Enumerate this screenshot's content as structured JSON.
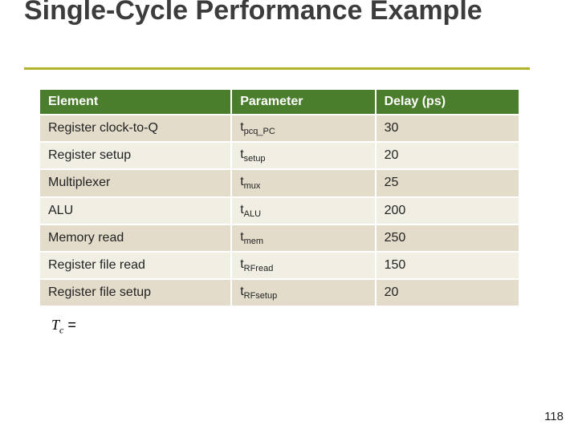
{
  "title": "Single-Cycle Performance Example",
  "table": {
    "headers": [
      "Element",
      "Parameter",
      "Delay (ps)"
    ],
    "rows": [
      {
        "element": "Register clock-to-Q",
        "param_base": "t",
        "param_sub": "pcq_PC",
        "delay": "30"
      },
      {
        "element": "Register setup",
        "param_base": "t",
        "param_sub": "setup",
        "delay": "20"
      },
      {
        "element": "Multiplexer",
        "param_base": "t",
        "param_sub": "mux",
        "delay": "25"
      },
      {
        "element": "ALU",
        "param_base": "t",
        "param_sub": "ALU",
        "delay": "200"
      },
      {
        "element": "Memory read",
        "param_base": "t",
        "param_sub": "mem",
        "delay": "250"
      },
      {
        "element": "Register file read",
        "param_base": "t",
        "param_sub": "RFread",
        "delay": "150"
      },
      {
        "element": "Register file setup",
        "param_base": "t",
        "param_sub": "RFsetup",
        "delay": "20"
      }
    ]
  },
  "formula": {
    "var": "T",
    "sub": "c",
    "eq": " = "
  },
  "page_number": "118"
}
